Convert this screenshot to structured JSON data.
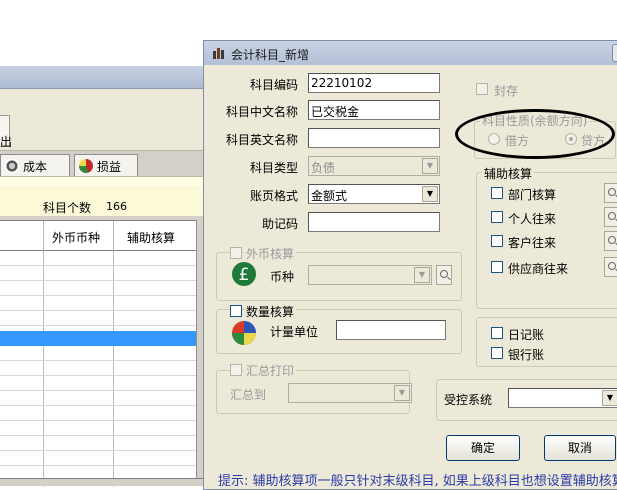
{
  "background_window": {
    "toolbar_button_label": "出",
    "tabs": [
      {
        "label": "成本",
        "icon": "gear-icon"
      },
      {
        "label": "损益",
        "icon": "pie-chart-icon"
      }
    ],
    "count_label": "科目个数",
    "count_value": "166",
    "table_headers": [
      "外币币种",
      "辅助核算"
    ]
  },
  "dialog": {
    "title": "会计科目_新增",
    "fields": {
      "code_label": "科目编码",
      "code_value": "22210102",
      "cn_name_label": "科目中文名称",
      "cn_name_value": "已交税金",
      "en_name_label": "科目英文名称",
      "en_name_value": "",
      "type_label": "科目类型",
      "type_value": "负债",
      "format_label": "账页格式",
      "format_value": "金额式",
      "mnemonic_label": "助记码",
      "mnemonic_value": ""
    },
    "foreign_currency": {
      "title": "外币核算",
      "currency_label": "币种",
      "currency_value": ""
    },
    "quantity": {
      "title": "数量核算",
      "unit_label": "计量单位",
      "unit_value": ""
    },
    "summary_print": {
      "title": "汇总打印",
      "summary_to_label": "汇总到",
      "summary_to_value": ""
    },
    "seal_label": "封存",
    "nature": {
      "title": "科目性质(余额方向)",
      "debit_label": "借方",
      "credit_label": "贷方"
    },
    "auxiliary": {
      "title": "辅助核算",
      "items": [
        "部门核算",
        "个人往来",
        "客户往来",
        "供应商往来"
      ]
    },
    "journal_label": "日记账",
    "bank_label": "银行账",
    "controlled_label": "受控系统",
    "controlled_value": "",
    "ok_label": "确定",
    "cancel_label": "取消",
    "hint": "提示: 辅助核算项一般只针对末级科目, 如果上级科目也想设置辅助核算,"
  }
}
